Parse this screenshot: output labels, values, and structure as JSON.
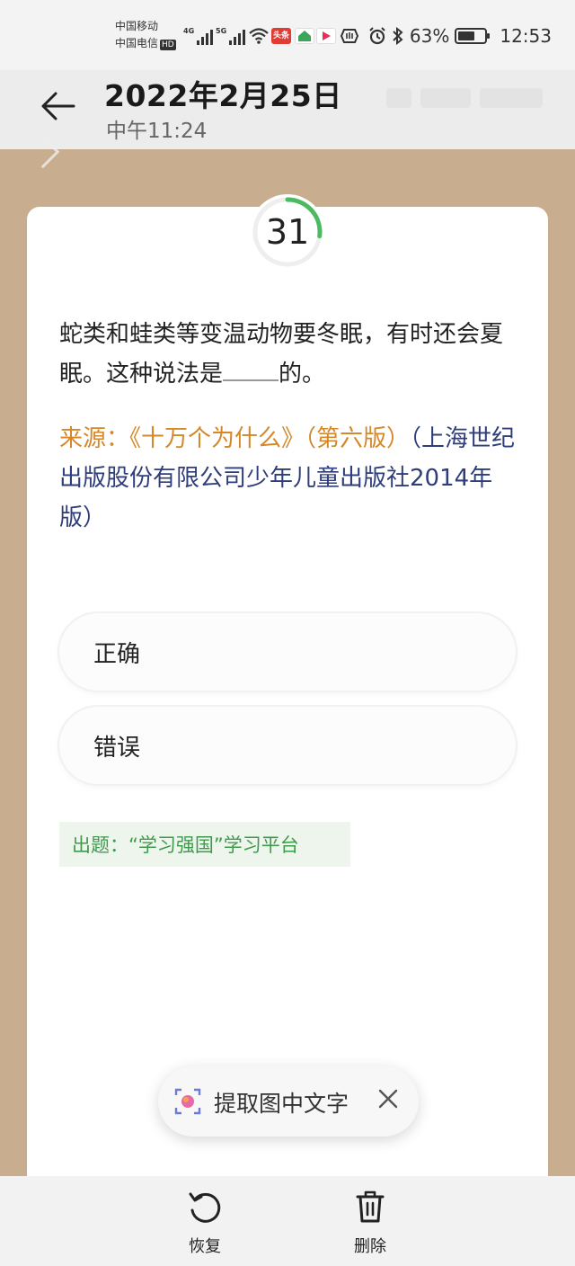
{
  "status_bar": {
    "carrier_1": "中国移动",
    "carrier_2": "中国电信",
    "hd_label": "HD",
    "network_1": "4G",
    "network_2": "5G",
    "app_badge_1": "头条",
    "battery_percent": "63%",
    "battery_level": 0.63,
    "time": "12:53"
  },
  "header": {
    "date": "2022年2月25日",
    "time": "中午11:24"
  },
  "quiz": {
    "question_number": "31",
    "progress": 0.27,
    "question_part_1": "蛇类和蛙类等变温动物要冬眠，有时还会夏眠。这种说法是",
    "question_part_2": "的。",
    "source_label": "来源：《十万个为什么》（第六版）",
    "source_detail": "（上海世纪出版股份有限公司少年儿童出版社2014年版）",
    "options": [
      {
        "label": "正确"
      },
      {
        "label": "错误"
      }
    ],
    "author_tag": "出题：“学习强国”学习平台"
  },
  "ocr_chip": {
    "label": "提取图中文字"
  },
  "toolbar": {
    "restore_label": "恢复",
    "delete_label": "删除"
  },
  "colors": {
    "accent_green": "#4cba60",
    "source_orange": "#d4882a",
    "source_blue": "#2f3e7a",
    "author_green": "#3f9b4c"
  }
}
